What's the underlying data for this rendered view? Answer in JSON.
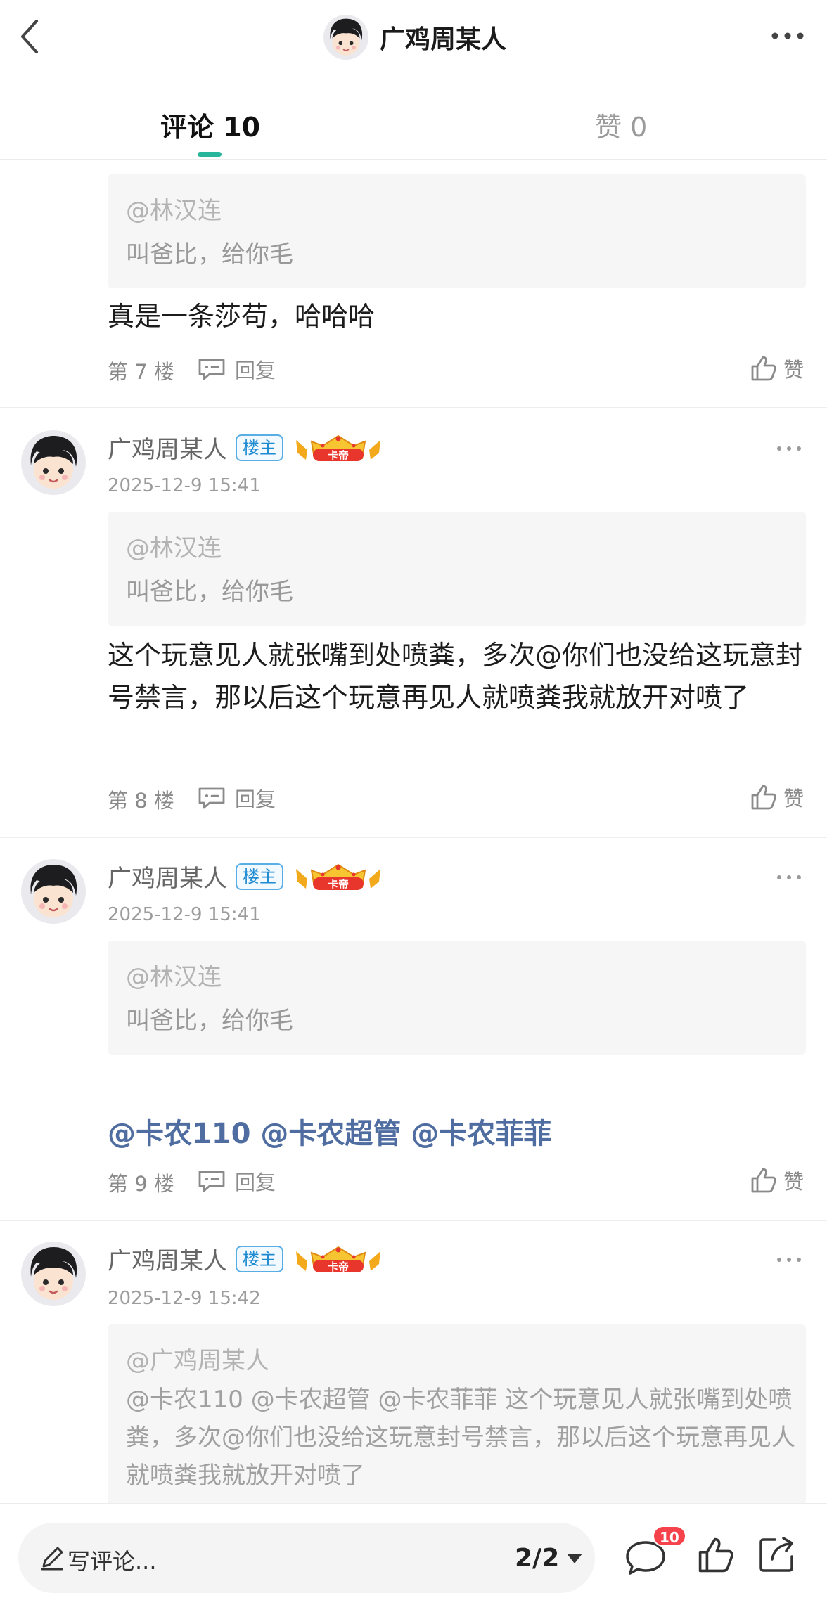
{
  "header": {
    "title": "广鸡周某人",
    "back_icon": "chevron-left-icon",
    "more_icon": "more-dots-icon"
  },
  "tabs": [
    {
      "label": "评论 10",
      "active": true
    },
    {
      "label": "赞 0",
      "active": false
    }
  ],
  "colors": {
    "accent": "#27b59b",
    "mention": "#4f6da0",
    "badge_red": "#f5424b",
    "op_badge": "#1e8bd0"
  },
  "comments": [
    {
      "quote_user": "@林汉连",
      "quote_text": "叫爸比，给你毛",
      "body": "真是一条莎苟，哈哈哈",
      "floor": "第 7 楼",
      "reply_label": "回复",
      "like_label": "赞"
    },
    {
      "author": "广鸡周某人",
      "op_badge": "楼主",
      "crown_label": "卡帝",
      "time": "2025-12-9 15:41",
      "quote_user": "@林汉连",
      "quote_text": "叫爸比，给你毛",
      "body": "这个玩意见人就张嘴到处喷粪，多次@你们也没给这玩意封号禁言，那以后这个玩意再见人就喷粪我就放开对喷了",
      "floor": "第 8 楼",
      "reply_label": "回复",
      "like_label": "赞"
    },
    {
      "author": "广鸡周某人",
      "op_badge": "楼主",
      "crown_label": "卡帝",
      "time": "2025-12-9 15:41",
      "quote_user": "@林汉连",
      "quote_text": "叫爸比，给你毛",
      "body": "@卡农110 @卡农超管 @卡农菲菲",
      "floor": "第 9 楼",
      "reply_label": "回复",
      "like_label": "赞"
    },
    {
      "author": "广鸡周某人",
      "op_badge": "楼主",
      "crown_label": "卡帝",
      "time": "2025-12-9 15:42",
      "quote_user": "@广鸡周某人",
      "quote_text": "@卡农110 @卡农超管 @卡农菲菲 这个玩意见人就张嘴到处喷粪，多次@你们也没给这玩意封号禁言，那以后这个玩意再见人就喷粪我就放开对喷了"
    }
  ],
  "bottom_bar": {
    "placeholder": "写评论...",
    "page_indicator": "2/2",
    "comment_count": "10"
  }
}
